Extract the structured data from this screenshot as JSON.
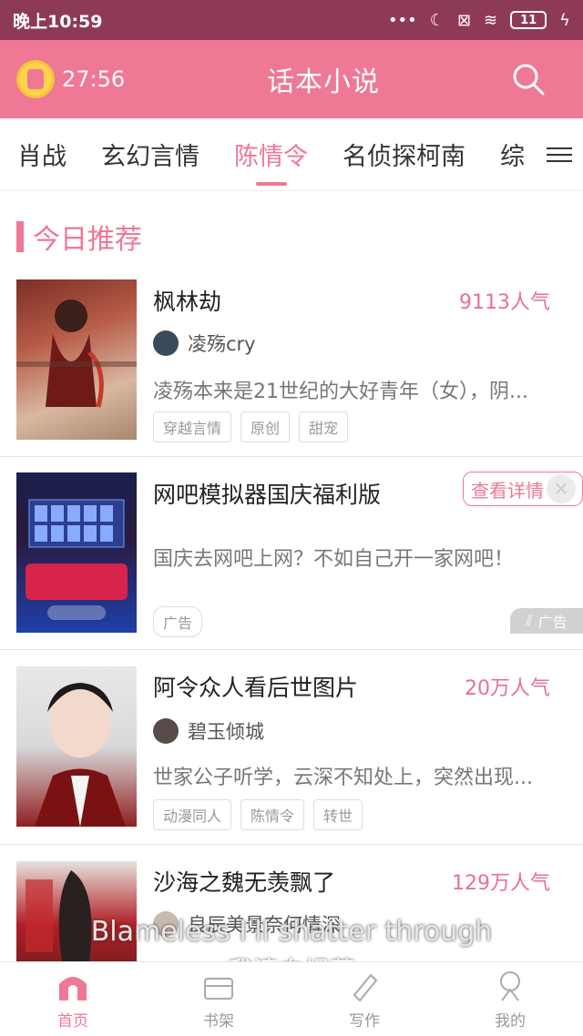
{
  "status_bar": {
    "time": "晚上10:59",
    "battery": "11"
  },
  "app_bar": {
    "timer": "27:56",
    "title": "话本小说"
  },
  "tabs": [
    {
      "label": "肖战"
    },
    {
      "label": "玄幻言情"
    },
    {
      "label": "陈情令"
    },
    {
      "label": "名侦探柯南"
    },
    {
      "label": "综"
    }
  ],
  "section": {
    "title": "今日推荐"
  },
  "items": [
    {
      "title": "枫林劫",
      "hot": "9113人气",
      "author": "凌殇cry",
      "desc": "凌殇本来是21世纪的大好青年（女），阴...",
      "tags": [
        "穿越言情",
        "原创",
        "甜宠"
      ]
    },
    {
      "title": "网吧模拟器国庆福利版",
      "cta": "查看详情",
      "desc": "国庆去网吧上网？不如自己开一家网吧！",
      "tag": "广告",
      "badge": "广告"
    },
    {
      "title": "阿令众人看后世图片",
      "hot": "20万人气",
      "author": "碧玉倾城",
      "desc": "世家公子听学，云深不知处上，突然出现...",
      "tags": [
        "动漫同人",
        "陈情令",
        "转世"
      ]
    },
    {
      "title": "沙海之魏无羡飘了",
      "hot": "129万人气",
      "author": "良辰美景奈何情深"
    }
  ],
  "subtitle": {
    "en": "Blameless I'll shatter through",
    "cn": "我清白坦荡"
  },
  "bottom_nav": [
    {
      "label": "首页"
    },
    {
      "label": "书架"
    },
    {
      "label": "写作"
    },
    {
      "label": "我的"
    }
  ],
  "colors": {
    "accent": "#ef7895",
    "status_bar": "#8e3a57"
  }
}
